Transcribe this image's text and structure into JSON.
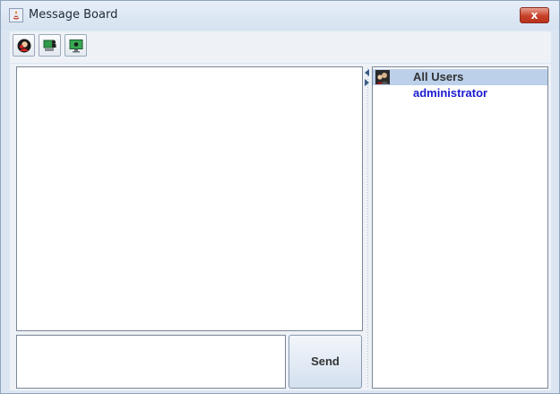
{
  "window": {
    "title": "Message Board",
    "close_glyph": "x"
  },
  "toolbar": {
    "buttons": [
      {
        "icon": "user-avatar-icon"
      },
      {
        "icon": "computer-user-icon"
      },
      {
        "icon": "monitor-icon"
      }
    ]
  },
  "message_area": {
    "text": ""
  },
  "input_area": {
    "value": ""
  },
  "send_button": {
    "label": "Send"
  },
  "users_panel": {
    "header": "All Users",
    "users": [
      "administrator"
    ]
  },
  "colors": {
    "accent": "#bcd0ea",
    "user_link": "#1a1ad0",
    "close": "#c8412a"
  }
}
